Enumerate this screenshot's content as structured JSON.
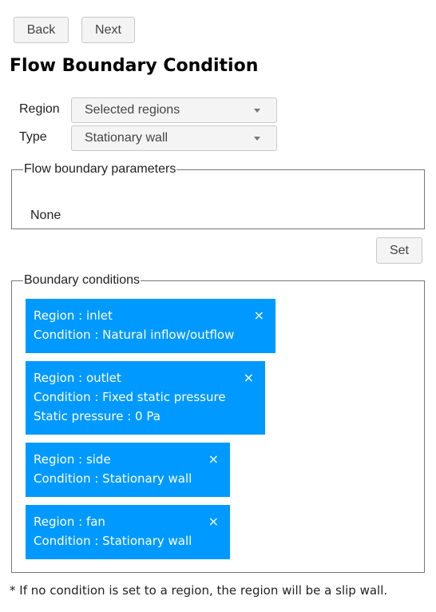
{
  "toolbar": {
    "back_label": "Back",
    "next_label": "Next"
  },
  "page": {
    "title": "Flow Boundary Condition"
  },
  "form": {
    "region_label": "Region",
    "region_value": "Selected regions",
    "type_label": "Type",
    "type_value": "Stationary wall"
  },
  "params": {
    "legend": "Flow boundary parameters",
    "content": "None"
  },
  "actions": {
    "set_label": "Set"
  },
  "boundary_conditions": {
    "legend": "Boundary conditions",
    "accent_color": "#0099ff",
    "close_icon": "×",
    "items": [
      {
        "lines": [
          "Region : inlet",
          "Condition : Natural inflow/outflow"
        ]
      },
      {
        "lines": [
          "Region : outlet",
          "Condition : Fixed static pressure",
          "Static pressure : 0 Pa"
        ]
      },
      {
        "lines": [
          "Region : side",
          "Condition : Stationary wall"
        ]
      },
      {
        "lines": [
          "Region : fan",
          "Condition : Stationary wall"
        ]
      }
    ]
  },
  "footnote": "* If no condition is set to a region, the region will be a slip wall."
}
